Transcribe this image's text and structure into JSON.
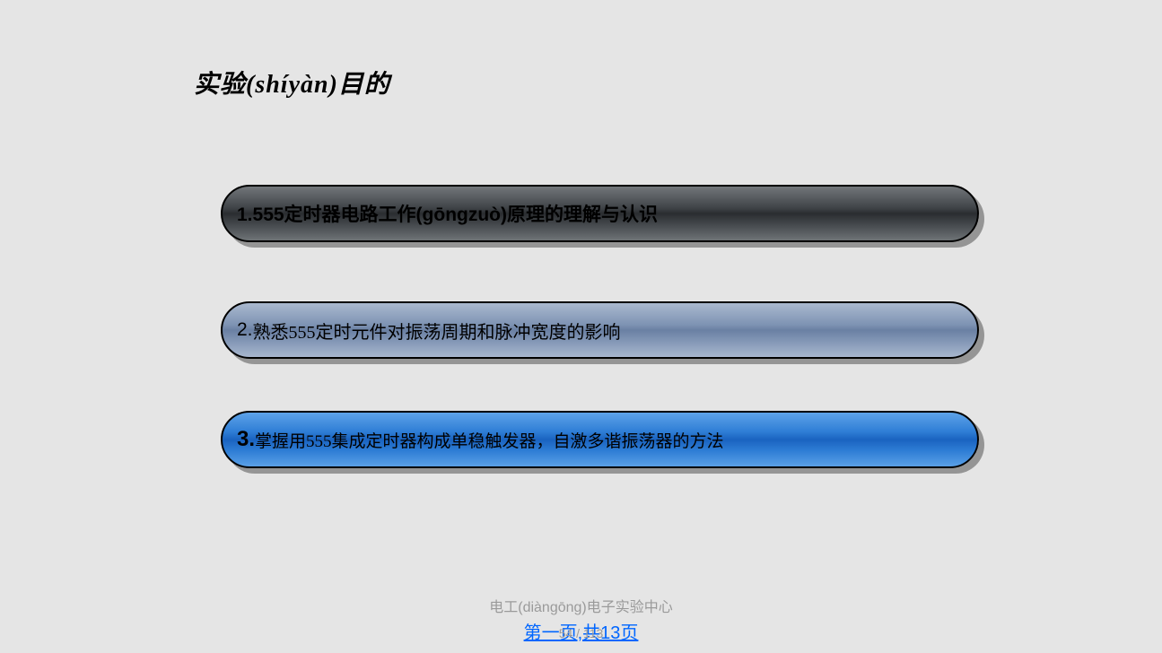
{
  "title": "实验(shíyàn)目的",
  "items": [
    {
      "text": "1.555定时器电路工作(gōngzuò)原理的理解与认识"
    },
    {
      "num": "2.",
      "text": "熟悉555定时元件对振荡周期和脉冲宽度的影响"
    },
    {
      "num": "3.",
      "text": "掌握用555集成定时器构成单稳触发器，自激多谐振荡器的方法"
    }
  ],
  "footer": {
    "line1": "电工(diàngōng)电子实验中心",
    "overlap": "54 / 113",
    "line2": "第一页,共13页"
  }
}
